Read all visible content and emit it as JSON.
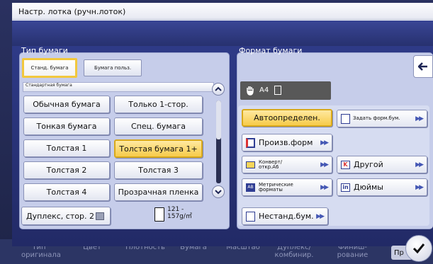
{
  "window": {
    "title": "Настр. лотка (ручн.лоток)"
  },
  "left_panel": {
    "title": "Тип бумаги",
    "tabs": [
      {
        "label": "Станд. бумага",
        "selected": true
      },
      {
        "label": "Бумага польз.",
        "selected": false
      }
    ],
    "section_label": "Стандартная бумага",
    "paper_types": [
      {
        "label": "Обычная бумага",
        "selected": false
      },
      {
        "label": "Только 1-стор.",
        "selected": false
      },
      {
        "label": "Тонкая бумага",
        "selected": false
      },
      {
        "label": "Спец. бумага",
        "selected": false
      },
      {
        "label": "Толстая 1",
        "selected": false
      },
      {
        "label": "Толстая бумага 1+",
        "selected": true
      },
      {
        "label": "Толстая 2",
        "selected": false
      },
      {
        "label": "Толстая 3",
        "selected": false
      },
      {
        "label": "Толстая 4",
        "selected": false
      },
      {
        "label": "Прозрачная пленка",
        "selected": false
      }
    ],
    "duplex_label": "Дуплекс, стор. 2",
    "weight_line1": "121 -",
    "weight_line2": "157g/㎡"
  },
  "right_panel": {
    "title": "Формат бумаги",
    "current_size": "A4",
    "buttons": {
      "auto": "Автоопределен.",
      "set_size": "Задать форм.бум.",
      "custom": "Произв.форм",
      "envelope": "Конверт/ откр.A6",
      "other": "Другой",
      "metric": "Метрические форматы",
      "inches": "Дюймы",
      "nonstandard": "Нестанд.бум."
    }
  },
  "bottom_bar": {
    "items": [
      {
        "label": "Тип оригинала"
      },
      {
        "label": "Цвет"
      },
      {
        "label": "Плотность"
      },
      {
        "label": "Бумага"
      },
      {
        "label": "Масштаб"
      },
      {
        "label": "Дуплекс/ комбинир."
      },
      {
        "label": "Финиш- рование"
      }
    ],
    "preview_label": "Пр"
  },
  "colors": {
    "accent": "#f7cb4a",
    "panel": "#c6cdea",
    "header": "#2e3a87"
  }
}
